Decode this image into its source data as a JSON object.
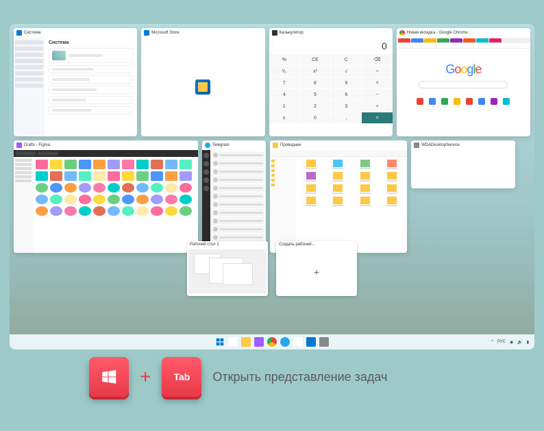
{
  "windows": {
    "settings": {
      "title": "Система",
      "icon_color": "#0078d4",
      "section": "Система"
    },
    "store": {
      "title": "Microsoft Store",
      "icon_color": "#0078d4"
    },
    "calc": {
      "title": "Калькулятор",
      "icon_color": "#333",
      "display": "0",
      "buttons": [
        "%",
        "CE",
        "C",
        "⌫",
        "¹⁄ₓ",
        "x²",
        "√",
        "÷",
        "7",
        "8",
        "9",
        "×",
        "4",
        "5",
        "6",
        "−",
        "1",
        "2",
        "3",
        "+",
        "±",
        "0",
        ",",
        "="
      ]
    },
    "chrome": {
      "title": "Новая вкладка - Google Chrome",
      "icon_color": "#4285f4",
      "logo": "Google"
    },
    "figma": {
      "title": "Drafts - Figma",
      "icon_color": "#a259ff"
    },
    "telegram": {
      "title": "Telegram",
      "icon_color": "#29a9eb"
    },
    "explorer": {
      "title": "Проводник",
      "icon_color": "#ffc845"
    },
    "wda": {
      "title": "WDADesktopService",
      "icon_color": "#888"
    }
  },
  "desktops": {
    "current": "Рабочий стол 1",
    "add": "Создать рабочий..."
  },
  "taskbar": {
    "lang": "РУС",
    "icons": [
      {
        "name": "start",
        "color": "#0078d4"
      },
      {
        "name": "search",
        "color": "#fff"
      },
      {
        "name": "explorer",
        "color": "#ffc845"
      },
      {
        "name": "figma",
        "color": "#a259ff"
      },
      {
        "name": "chrome",
        "color": "#4285f4"
      },
      {
        "name": "telegram",
        "color": "#29a9eb"
      },
      {
        "name": "calc",
        "color": "#fff"
      },
      {
        "name": "store",
        "color": "#0078d4"
      },
      {
        "name": "settings",
        "color": "#888"
      }
    ]
  },
  "hotkey": {
    "key2": "Tab",
    "plus": "+",
    "label": "Открыть представление задач"
  },
  "colors": {
    "figma_tiles": [
      "#ff6b9d",
      "#ffd93d",
      "#6bcf7f",
      "#4d96ff",
      "#ff9f43",
      "#a29bfe",
      "#fd79a8",
      "#00cec9",
      "#e17055",
      "#74b9ff",
      "#55efc4",
      "#ffeaa7"
    ],
    "chrome_apps": [
      "#ea4335",
      "#4285f4",
      "#34a853",
      "#fbbc05",
      "#ea4335",
      "#4285f4",
      "#9c27b0",
      "#00bcd4"
    ],
    "chrome_tabs": [
      "#ea4335",
      "#4285f4",
      "#fbbc05",
      "#34a853",
      "#9c27b0",
      "#ff5722",
      "#00bcd4",
      "#e91e63"
    ]
  }
}
